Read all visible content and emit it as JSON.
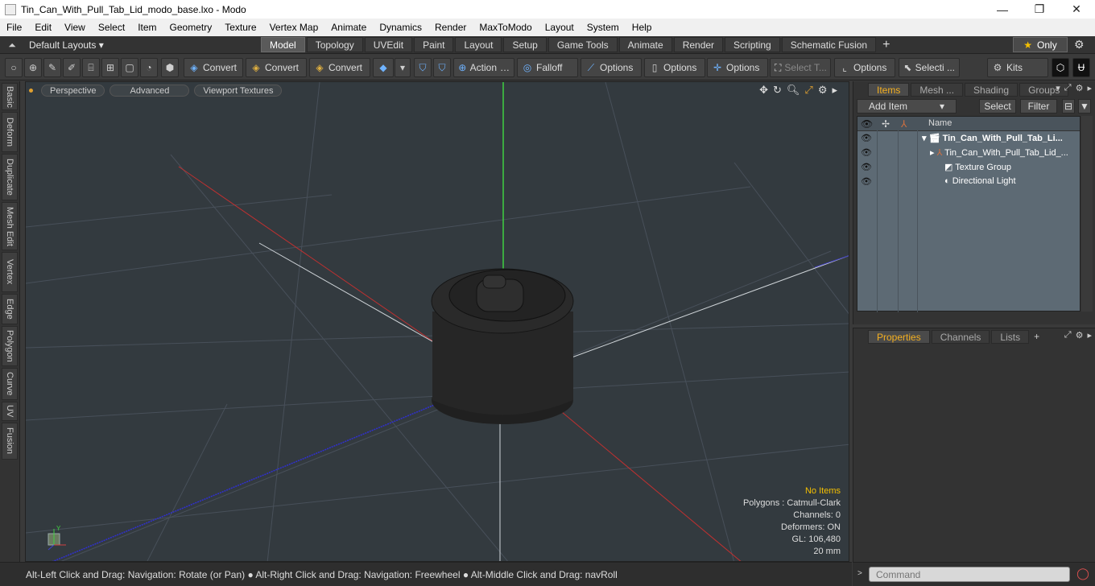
{
  "window": {
    "title": "Tin_Can_With_Pull_Tab_Lid_modo_base.lxo - Modo",
    "minimize": "—",
    "maximize": "❐",
    "close": "✕"
  },
  "menubar": [
    "File",
    "Edit",
    "View",
    "Select",
    "Item",
    "Geometry",
    "Texture",
    "Vertex Map",
    "Animate",
    "Dynamics",
    "Render",
    "MaxToModo",
    "Layout",
    "System",
    "Help"
  ],
  "layoutbar": {
    "layouts_label": "Default Layouts ▾",
    "tabs": [
      "Model",
      "Topology",
      "UVEdit",
      "Paint",
      "Layout",
      "Setup",
      "Game Tools",
      "Animate",
      "Render",
      "Scripting",
      "Schematic Fusion"
    ],
    "active_tab": "Model",
    "add_tab": "+",
    "only_label": "Only"
  },
  "toolbar": {
    "convert1": "Convert",
    "convert2": "Convert",
    "convert3": "Convert",
    "action": "Action",
    "falloff": "Falloff",
    "options1": "Options",
    "options2": "Options",
    "options3": "Options",
    "select_t": "Select T...",
    "options4": "Options",
    "selecti": "Selecti ...",
    "kits": "Kits"
  },
  "left_tabs": [
    "Basic",
    "Deform",
    "Duplicate",
    "Mesh Edit",
    "Vertex",
    "Edge",
    "Polygon",
    "Curve",
    "UV",
    "Fusion"
  ],
  "viewport": {
    "perspective": "Perspective",
    "advanced": "Advanced",
    "viewport_textures": "Viewport Textures",
    "info": {
      "no_items": "No Items",
      "polygons": "Polygons : Catmull-Clark",
      "channels": "Channels: 0",
      "deformers": "Deformers: ON",
      "gl": "GL: 106,480",
      "scale": "20 mm"
    },
    "gizmo_y": "Y"
  },
  "statusbar": {
    "text": "Alt-Left Click and Drag: Navigation: Rotate (or Pan) ● Alt-Right Click and Drag: Navigation: Freewheel ● Alt-Middle Click and Drag: navRoll"
  },
  "items_panel": {
    "tabs": [
      "Items",
      "Mesh ...",
      "Shading",
      "Groups"
    ],
    "active_tab": "Items",
    "add_item": "Add Item",
    "select": "Select",
    "filter": "Filter",
    "column_name": "Name",
    "rows": [
      {
        "label": "Tin_Can_With_Pull_Tab_Li...",
        "indent": 0
      },
      {
        "label": "Tin_Can_With_Pull_Tab_Lid_...",
        "indent": 1
      },
      {
        "label": "Texture Group",
        "indent": 1
      },
      {
        "label": "Directional Light",
        "indent": 1
      }
    ]
  },
  "properties_panel": {
    "tabs": [
      "Properties",
      "Channels",
      "Lists"
    ],
    "active_tab": "Properties",
    "add": "+"
  },
  "command": {
    "placeholder": "Command"
  }
}
